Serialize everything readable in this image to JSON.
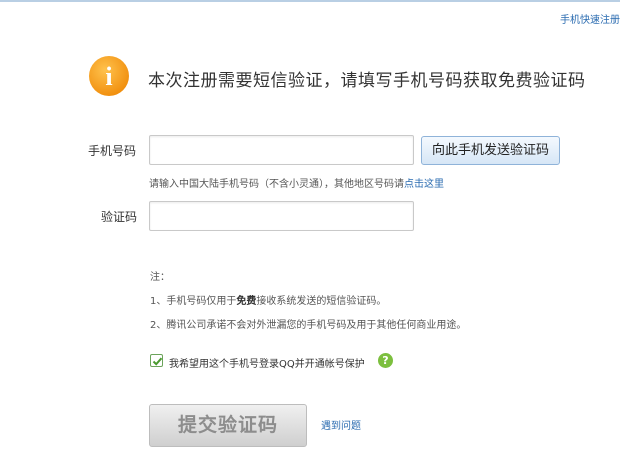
{
  "top_link": "手机快速注册",
  "headline": "本次注册需要短信验证，请填写手机号码获取免费验证码",
  "info_icon_glyph": "i",
  "form": {
    "phone_label": "手机号码",
    "phone_value": "",
    "send_button": "向此手机发送验证码",
    "hint_text": "请输入中国大陆手机号码（不含小灵通），其他地区号码请",
    "hint_link": "点击这里",
    "code_label": "验证码",
    "code_value": ""
  },
  "notes": {
    "title": "注：",
    "item1_prefix": "1、手机号码仅用于",
    "item1_bold": "免费",
    "item1_suffix": "接收系统发送的短信验证码。",
    "item2": "2、腾讯公司承诺不会对外泄漏您的手机号码及用于其他任何商业用途。"
  },
  "checkbox": {
    "checked": true,
    "label": "我希望用这个手机号登录QQ并开通帐号保护",
    "help_glyph": "?"
  },
  "submit_button": "提交验证码",
  "problem_link": "遇到问题",
  "colors": {
    "accent_blue": "#2a6bb0",
    "info_orange": "#f49a14",
    "help_green": "#7cbf3e",
    "check_green": "#4a9a2f"
  }
}
